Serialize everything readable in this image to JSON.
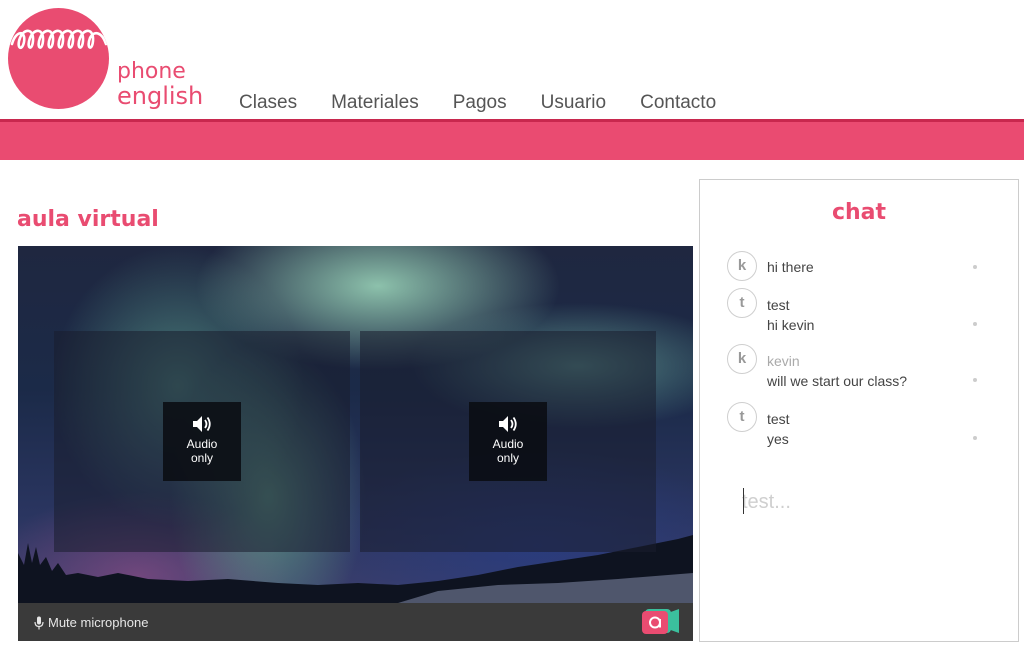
{
  "brand": {
    "line1": "phone",
    "line2": "english",
    "color": "#e94c71"
  },
  "nav": {
    "items": [
      "Clases",
      "Materiales",
      "Pagos",
      "Usuario",
      "Contacto"
    ]
  },
  "section_title": "aula virtual",
  "video": {
    "tiles": [
      {
        "label_line1": "Audio",
        "label_line2": "only"
      },
      {
        "label_line1": "Audio",
        "label_line2": "only"
      }
    ],
    "mute_label": "Mute microphone"
  },
  "chat": {
    "title": "chat",
    "messages": [
      {
        "avatar": "k",
        "lines": [
          "hi there"
        ]
      },
      {
        "avatar": "t",
        "lines": [
          "test",
          "hi kevin"
        ]
      },
      {
        "avatar": "k",
        "lines": [
          "kevin",
          "will we start our class?"
        ]
      },
      {
        "avatar": "t",
        "lines": [
          "test",
          "yes"
        ]
      }
    ],
    "input_placeholder": "test..."
  },
  "colors": {
    "accent": "#e94c71",
    "band": "#ea4b71",
    "control_bar": "#3a3a3a"
  }
}
